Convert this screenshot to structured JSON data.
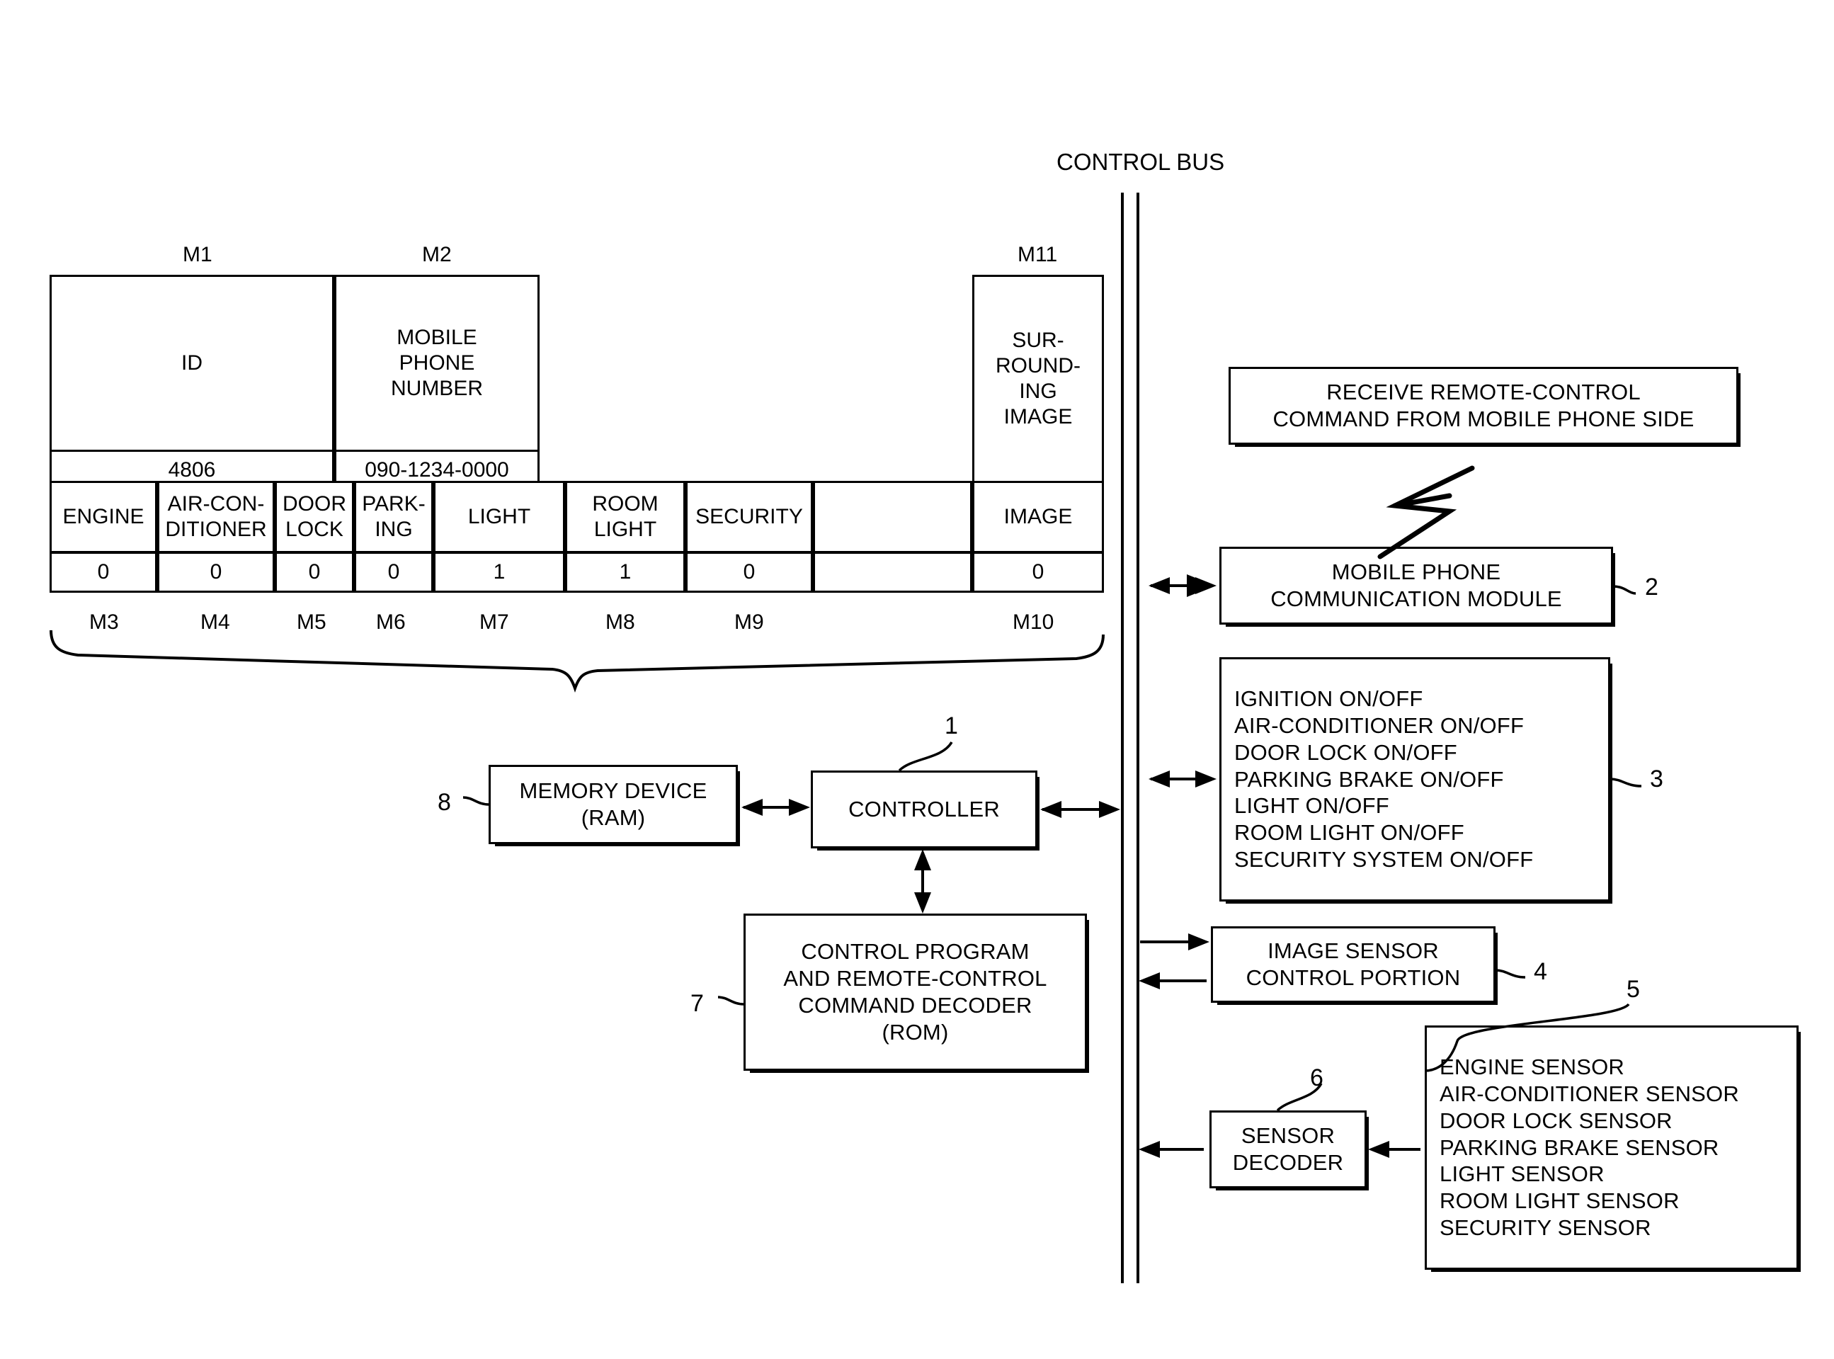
{
  "diagram": {
    "control_bus_label": "CONTROL BUS"
  },
  "memory_table": {
    "group_labels": {
      "m1": "M1",
      "m2": "M2",
      "m11": "M11"
    },
    "header_row": [
      {
        "key": "id",
        "label": "ID"
      },
      {
        "key": "mobile_phone_number",
        "label": "MOBILE\nPHONE\nNUMBER"
      },
      {
        "key": "surrounding_image",
        "label": "SUR-\nROUND-\nING\nIMAGE"
      }
    ],
    "value_row": [
      {
        "key": "id_value",
        "label": "4806"
      },
      {
        "key": "phone_value",
        "label": "090-1234-0000"
      }
    ],
    "status_headers": [
      {
        "tag": "M3",
        "label": "ENGINE"
      },
      {
        "tag": "M4",
        "label": "AIR-CON-\nDITIONER"
      },
      {
        "tag": "M5",
        "label": "DOOR\nLOCK"
      },
      {
        "tag": "M6",
        "label": "PARK-\nING"
      },
      {
        "tag": "M7",
        "label": "LIGHT"
      },
      {
        "tag": "M8",
        "label": "ROOM\nLIGHT"
      },
      {
        "tag": "M9",
        "label": "SECURITY"
      },
      {
        "tag": "M10",
        "label": "IMAGE"
      }
    ],
    "status_values": [
      "0",
      "0",
      "0",
      "0",
      "1",
      "1",
      "0",
      "0"
    ],
    "bottom_tags": [
      "M3",
      "M4",
      "M5",
      "M6",
      "M7",
      "M8",
      "M9",
      "M10"
    ]
  },
  "blocks": {
    "receive_command": {
      "label": "RECEIVE REMOTE-CONTROL\nCOMMAND FROM MOBILE PHONE SIDE",
      "ref": ""
    },
    "mobile_module": {
      "label": "MOBILE PHONE\nCOMMUNICATION MODULE",
      "ref": "2"
    },
    "onoff_list": {
      "label": "IGNITION ON/OFF\nAIR-CONDITIONER ON/OFF\nDOOR LOCK ON/OFF\nPARKING BRAKE ON/OFF\nLIGHT ON/OFF\nROOM LIGHT ON/OFF\nSECURITY SYSTEM ON/OFF",
      "ref": "3"
    },
    "image_sensor": {
      "label": "IMAGE SENSOR\nCONTROL PORTION",
      "ref": "4"
    },
    "sensor_list": {
      "label": "ENGINE SENSOR\nAIR-CONDITIONER SENSOR\nDOOR LOCK SENSOR\nPARKING BRAKE SENSOR\nLIGHT SENSOR\nROOM LIGHT SENSOR\nSECURITY SENSOR",
      "ref": "5"
    },
    "sensor_decoder": {
      "label": "SENSOR\nDECODER",
      "ref": "6"
    },
    "controller": {
      "label": "CONTROLLER",
      "ref": "1"
    },
    "memory_device": {
      "label": "MEMORY DEVICE\n(RAM)",
      "ref": "8"
    },
    "control_program": {
      "label": "CONTROL PROGRAM\nAND REMOTE-CONTROL\nCOMMAND DECODER\n(ROM)",
      "ref": "7"
    }
  },
  "icons": {
    "lightning": "lightning-bolt-icon",
    "brace": "curly-brace-icon"
  }
}
